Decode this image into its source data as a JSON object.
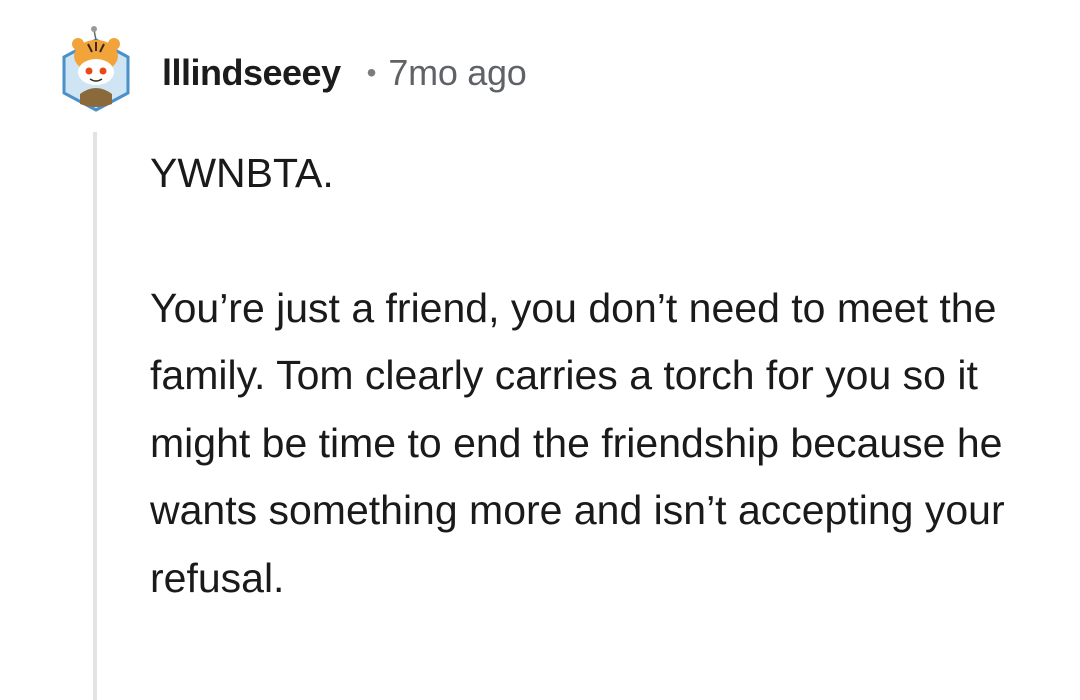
{
  "comment": {
    "username": "lllindseeey",
    "separator": "•",
    "timestamp": "7mo ago",
    "paragraphs": [
      "YWNBTA.",
      "You’re just a friend, you don’t need to meet the family. Tom clearly carries a torch for you so it might be time to end the friendship because he wants something more and isn’t accepting your refusal."
    ]
  },
  "colors": {
    "username": "#1c1c1c",
    "timestamp": "#5f6368",
    "thread_line": "#e3e3e3",
    "avatar_border": "#4a90c9",
    "avatar_tiger": "#f2a33a"
  },
  "icons": {
    "avatar": "snoo-tiger-avatar"
  }
}
